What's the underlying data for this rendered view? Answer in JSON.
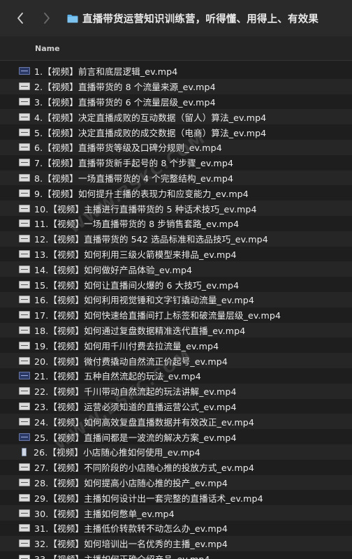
{
  "toolbar": {
    "title": "直播带货运营知识训练营，听得懂、用得上、有效果"
  },
  "columns": {
    "name": "Name"
  },
  "files": [
    {
      "name": "1.【视频】前言和底层逻辑_ev.mp4",
      "thumb": "dark"
    },
    {
      "name": "2.【视频】直播带货的 8 个流量来源_ev.mp4",
      "thumb": "light"
    },
    {
      "name": "3.【视频】直播带货的 6 个流量层级_ev.mp4",
      "thumb": "light"
    },
    {
      "name": "4.【视频】决定直播成败的互动数据（留人）算法_ev.mp4",
      "thumb": "light"
    },
    {
      "name": "5.【视频】决定直播成败的成交数据（电商）算法_ev.mp4",
      "thumb": "light"
    },
    {
      "name": "6.【视频】直播带货等级及口碑分规则_ev.mp4",
      "thumb": "light"
    },
    {
      "name": "7.【视频】直播带货新手起号的 8 个步骤_ev.mp4",
      "thumb": "light"
    },
    {
      "name": "8.【视频】一场直播带货的 4 个完整结构_ev.mp4",
      "thumb": "light"
    },
    {
      "name": "9.【视频】如何提升主播的表现力和应变能力_ev.mp4",
      "thumb": "light"
    },
    {
      "name": "10.【视频】主播进行直播带货的 5 种话术技巧_ev.mp4",
      "thumb": "light"
    },
    {
      "name": "11.【视频】一场直播带货的 8 步销售套路_ev.mp4",
      "thumb": "light"
    },
    {
      "name": "12.【视频】直播带货的 542 选品标准和选品技巧_ev.mp4",
      "thumb": "light"
    },
    {
      "name": "13.【视频】如何利用三级火箭模型来排品_ev.mp4",
      "thumb": "light"
    },
    {
      "name": "14.【视频】如何做好产品体验_ev.mp4",
      "thumb": "light"
    },
    {
      "name": "15.【视频】如何让直播间火爆的 6 大技巧_ev.mp4",
      "thumb": "light"
    },
    {
      "name": "16.【视频】如何利用视觉锤和文字钉撬动流量_ev.mp4",
      "thumb": "light"
    },
    {
      "name": "17.【视频】如何快速给直播间打上标签和破流量层级_ev.mp4",
      "thumb": "light"
    },
    {
      "name": "18.【视频】如何通过复盘数据精准迭代直播_ev.mp4",
      "thumb": "light"
    },
    {
      "name": "19.【视频】如何用千川付费去拉流量_ev.mp4",
      "thumb": "light"
    },
    {
      "name": "20.【视频】微付费撬动自然流正价起号_ev.mp4",
      "thumb": "light"
    },
    {
      "name": "21.【视频】五种自然流起的玩法_ev.mp4",
      "thumb": "dark"
    },
    {
      "name": "22.【视频】千川带动自然流起的玩法讲解_ev.mp4",
      "thumb": "light"
    },
    {
      "name": "23.【视频】运营必须知道的直播运营公式_ev.mp4",
      "thumb": "light"
    },
    {
      "name": "24.【视频】如何高效复盘直播数据并有效改正_ev.mp4",
      "thumb": "light"
    },
    {
      "name": "25.【视频】直播间都是一波流的解决方案_ev.mp4",
      "thumb": "dark"
    },
    {
      "name": "26.【视频】小店随心推如何使用_ev.mp4",
      "thumb": "vert"
    },
    {
      "name": "27.【视频】不同阶段的小店随心推的投放方式_ev.mp4",
      "thumb": "light"
    },
    {
      "name": "28.【视频】如何提高小店随心推的投产_ev.mp4",
      "thumb": "light"
    },
    {
      "name": "29.【视频】主播如何设计出一套完整的直播话术_ev.mp4",
      "thumb": "light"
    },
    {
      "name": "30.【视频】主播如何憋单_ev.mp4",
      "thumb": "light"
    },
    {
      "name": "31.【视频】主播低价转款转不动怎么办_ev.mp4",
      "thumb": "light"
    },
    {
      "name": "32.【视频】如何培训出一名优秀的主播_ev.mp4",
      "thumb": "light"
    },
    {
      "name": "33.【视频】主播如何正确介绍产品_ev.mp4",
      "thumb": "light"
    }
  ],
  "icons": {
    "back": "chevron-left-icon",
    "forward": "chevron-right-icon",
    "folder": "folder-icon",
    "file": "video-file-icon"
  },
  "colors": {
    "folder": "#5bb0e8",
    "background": "#1e1e1e",
    "toolbar": "#2a2a2a"
  }
}
